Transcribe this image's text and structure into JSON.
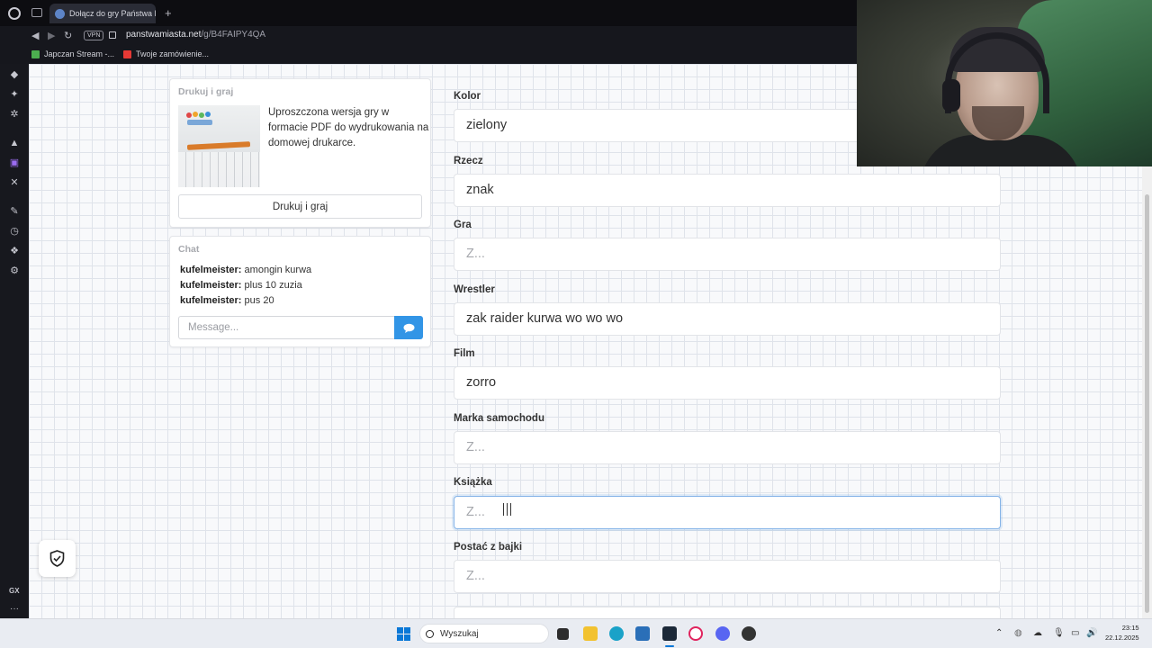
{
  "browser": {
    "tab_title": "Dołącz do gry Państwa M",
    "new_tab_glyph": "+",
    "url_domain": "panstwamiasta.net",
    "url_path": "/g/B4FAIPY4QA",
    "vpn_label": "VPN",
    "bookmarks": [
      {
        "label": "Japczan Stream -...",
        "color": "#4caf50"
      },
      {
        "label": "Twoje zamówienie...",
        "color": "#e53935"
      }
    ]
  },
  "sidebar": {
    "gx_label": "GX",
    "more_label": "···"
  },
  "print_card": {
    "heading": "Drukuj i graj",
    "description": "Uproszczona wersja gry w formacie PDF do wydrukowania na domowej drukarce.",
    "button_label": "Drukuj i graj"
  },
  "chat": {
    "heading": "Chat",
    "messages": [
      {
        "user": "kufelmeister:",
        "text": "amongin kurwa"
      },
      {
        "user": "kufelmeister:",
        "text": "plus 10 zuzia"
      },
      {
        "user": "kufelmeister:",
        "text": "pus 20"
      }
    ],
    "input_placeholder": "Message...",
    "send_color": "#3295e6"
  },
  "fields": [
    {
      "label": "Kolor",
      "value": "zielony",
      "placeholder": "Z..."
    },
    {
      "label": "Rzecz",
      "value": "znak",
      "placeholder": "Z..."
    },
    {
      "label": "Gra",
      "value": "",
      "placeholder": "Z..."
    },
    {
      "label": "Wrestler",
      "value": "zak raider kurwa wo wo wo",
      "placeholder": "Z..."
    },
    {
      "label": "Film",
      "value": "zorro",
      "placeholder": "Z..."
    },
    {
      "label": "Marka samochodu",
      "value": "",
      "placeholder": "Z..."
    },
    {
      "label": "Książka",
      "value": "",
      "placeholder": "Z...",
      "focused": true
    },
    {
      "label": "Postać z bajki",
      "value": "",
      "placeholder": "Z..."
    }
  ],
  "taskbar": {
    "search_placeholder": "Wyszukaj",
    "time": "23:15",
    "date": "22.12.2025",
    "accent": "#0a78d7"
  }
}
